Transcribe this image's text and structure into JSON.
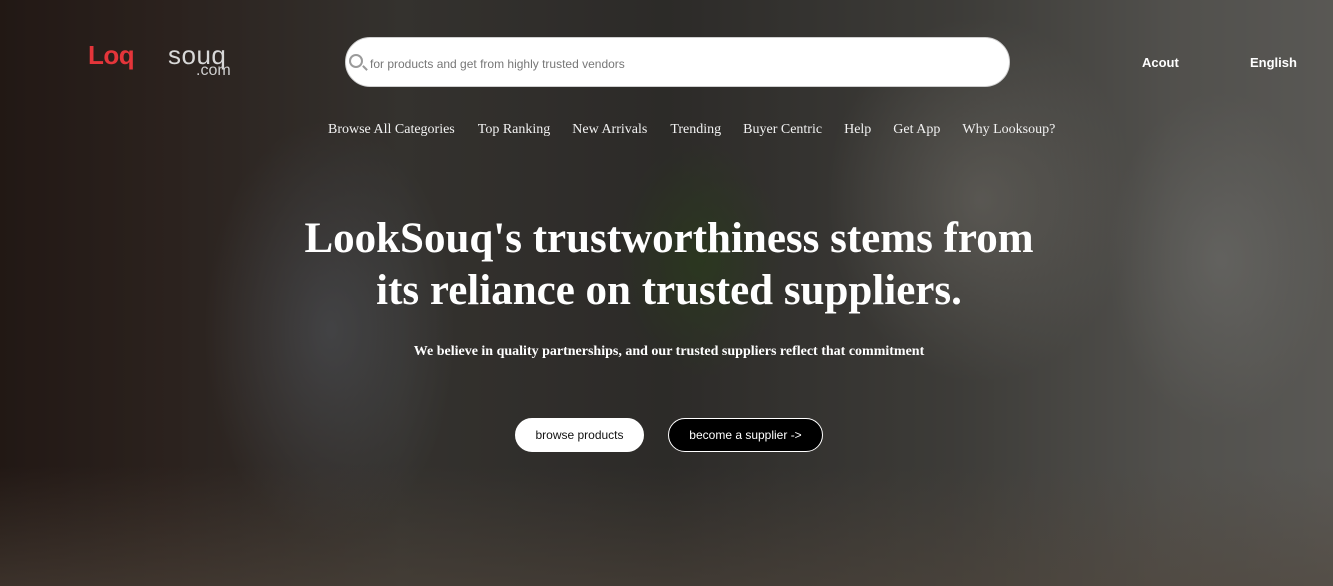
{
  "logo": {
    "part1": "Loq",
    "part2": "souq",
    "part3": ".com"
  },
  "search": {
    "placeholder": "for products and get from highly trusted vendors",
    "value": ""
  },
  "header": {
    "account_label": "Acout",
    "language_label": "English"
  },
  "nav": {
    "items": [
      {
        "label": "Browse All Categories"
      },
      {
        "label": "Top Ranking"
      },
      {
        "label": "New Arrivals"
      },
      {
        "label": "Trending"
      },
      {
        "label": "Buyer Centric"
      },
      {
        "label": "Help"
      },
      {
        "label": "Get App"
      },
      {
        "label": "Why Looksoup?"
      }
    ]
  },
  "hero": {
    "headline_line1": "LookSouq's trustworthiness stems from",
    "headline_line2": "its reliance on trusted suppliers.",
    "subtitle": "We believe in quality partnerships, and our trusted suppliers reflect that commitment",
    "primary_button": "browse products",
    "secondary_button": "become a supplier ->"
  },
  "colors": {
    "brand_red": "#e4353a",
    "text_light": "#ffffff"
  },
  "icons": {
    "search": "search-icon"
  }
}
